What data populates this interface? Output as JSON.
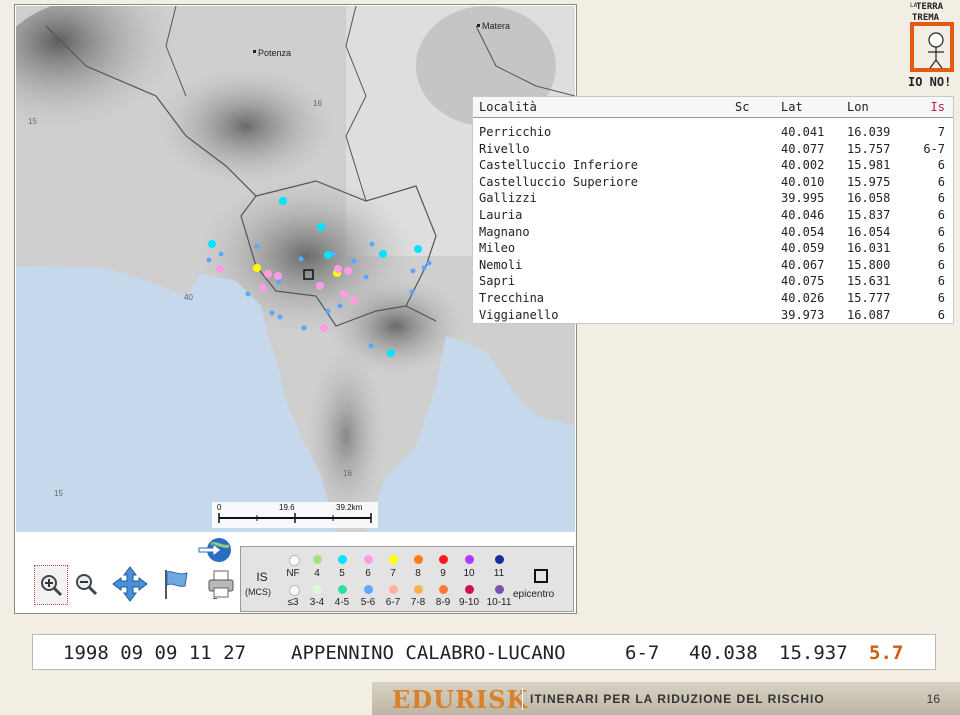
{
  "map": {
    "towns": {
      "potenza": "Potenza",
      "matera": "Matera"
    },
    "grid_labels": {
      "lon15_top": "15",
      "lon16_top": "16",
      "lat40": "40",
      "lon15_bottom": "15",
      "lon16_bottom": "16",
      "lon15_left": "15"
    },
    "scalebar": {
      "zero": "0",
      "mid": "19.6",
      "end": "39.2km"
    }
  },
  "toolbar": {
    "zoom_in": "zoom-in-icon",
    "zoom_out": "zoom-out-icon",
    "pan": "pan-arrows-icon",
    "flag": "flag-icon",
    "globe": "google-earth-icon",
    "print": "printer-icon"
  },
  "legend": {
    "title": "IS",
    "scale": "(MCS)",
    "top_labels": [
      "NF",
      "4",
      "5",
      "6",
      "7",
      "8",
      "9",
      "10",
      "11"
    ],
    "bottom_labels": [
      "≤3",
      "3-4",
      "4-5",
      "5-6",
      "6-7",
      "7-8",
      "8-9",
      "9-10",
      "10-11"
    ],
    "top_colors": [
      "#ffffff",
      "#a8e07a",
      "#00e4ff",
      "#ff9de4",
      "#ffff00",
      "#ff7a1a",
      "#ff1a1a",
      "#b03aff",
      "#1a2a9a"
    ],
    "bottom_colors": [
      "#f8f8f8",
      "#d6ffd0",
      "#30e0a0",
      "#5aa8ff",
      "#ffb0a0",
      "#ffb050",
      "#ff7a3a",
      "#d01050",
      "#8050b0"
    ],
    "epicentre_label": "epicentro"
  },
  "table": {
    "headers": {
      "loc": "Località",
      "sc": "Sc",
      "lat": "Lat",
      "lon": "Lon",
      "is": "Is"
    },
    "rows": [
      {
        "loc": "Perricchio",
        "sc": "",
        "lat": "40.041",
        "lon": "16.039",
        "is": "7"
      },
      {
        "loc": "Rivello",
        "sc": "",
        "lat": "40.077",
        "lon": "15.757",
        "is": "6-7"
      },
      {
        "loc": "Castelluccio Inferiore",
        "sc": "",
        "lat": "40.002",
        "lon": "15.981",
        "is": "6"
      },
      {
        "loc": "Castelluccio Superiore",
        "sc": "",
        "lat": "40.010",
        "lon": "15.975",
        "is": "6"
      },
      {
        "loc": "Gallizzi",
        "sc": "",
        "lat": "39.995",
        "lon": "16.058",
        "is": "6"
      },
      {
        "loc": "Lauria",
        "sc": "",
        "lat": "40.046",
        "lon": "15.837",
        "is": "6"
      },
      {
        "loc": "Magnano",
        "sc": "",
        "lat": "40.054",
        "lon": "16.054",
        "is": "6"
      },
      {
        "loc": "Mileo",
        "sc": "",
        "lat": "40.059",
        "lon": "16.031",
        "is": "6"
      },
      {
        "loc": "Nemoli",
        "sc": "",
        "lat": "40.067",
        "lon": "15.800",
        "is": "6"
      },
      {
        "loc": "Sapri",
        "sc": "",
        "lat": "40.075",
        "lon": "15.631",
        "is": "6"
      },
      {
        "loc": "Trecchina",
        "sc": "",
        "lat": "40.026",
        "lon": "15.777",
        "is": "6"
      },
      {
        "loc": "Viggianello",
        "sc": "",
        "lat": "39.973",
        "lon": "16.087",
        "is": "6"
      }
    ]
  },
  "logo": {
    "line1": "TERRA",
    "line2": "TREMA",
    "line3": "IO NO!",
    "small": "LA"
  },
  "event": {
    "date": "1998 09 09 11 27",
    "area": "APPENNINO CALABRO-LUCANO",
    "intensity": "6-7",
    "lat": "40.038",
    "lon": "15.937",
    "magnitude": "5.7"
  },
  "footer": {
    "brand": "EDURISK",
    "subtitle": "ITINERARI PER LA RIDUZIONE DEL RISCHIO",
    "page": "16"
  }
}
